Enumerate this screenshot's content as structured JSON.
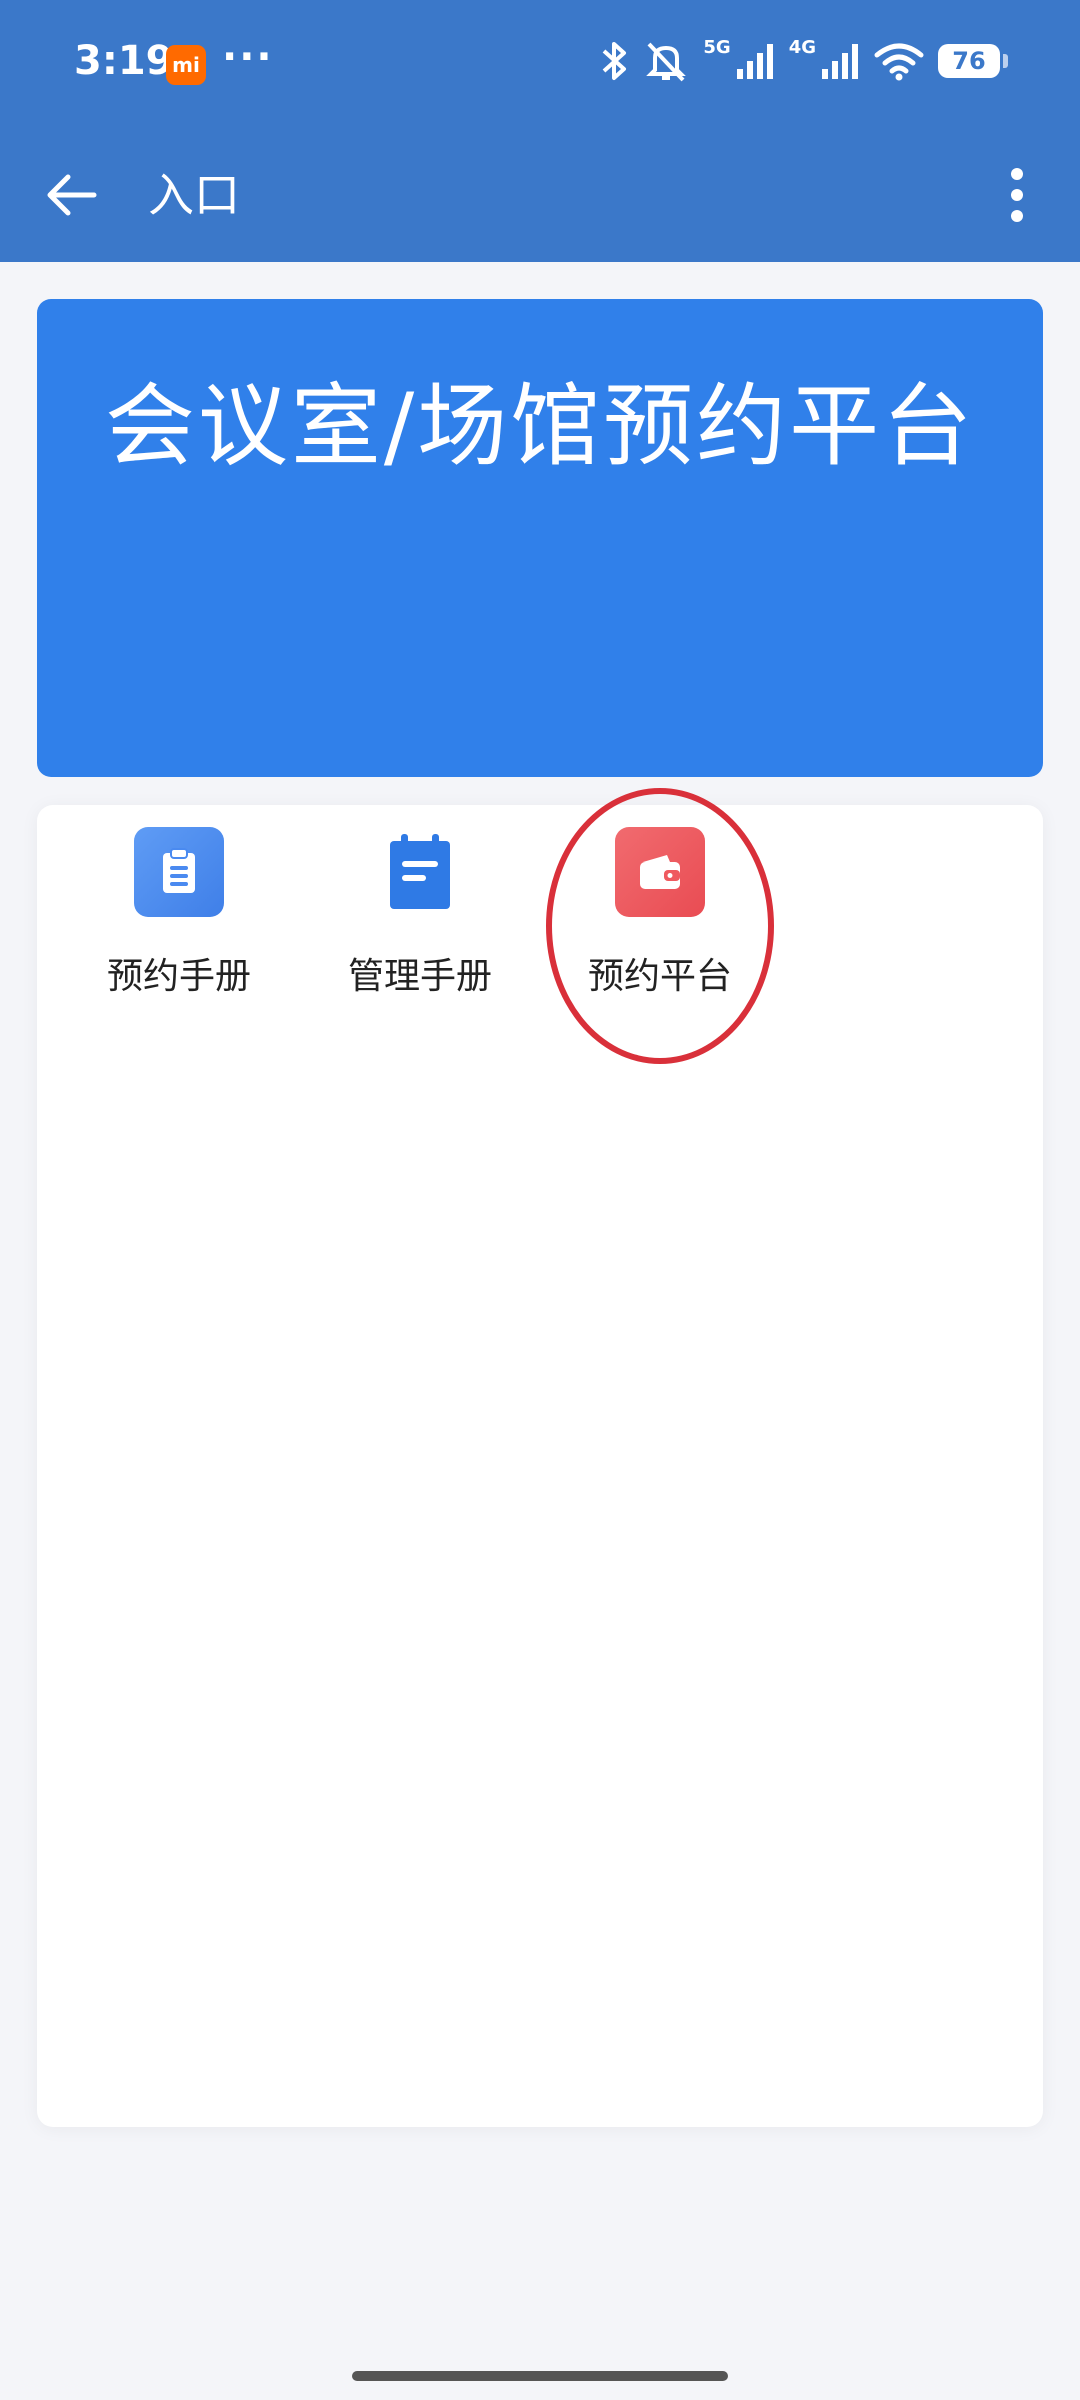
{
  "status_bar": {
    "time": "3:19",
    "badge": "mi",
    "more": "···",
    "network_5g": "5G",
    "network_4g": "4G",
    "battery": "76"
  },
  "app_bar": {
    "title": "入口",
    "back_icon": "arrow-left-icon",
    "menu_icon": "more-vertical-icon"
  },
  "banner": {
    "title": "会议室/场馆预约平台",
    "color": "#3080ea"
  },
  "tiles": [
    {
      "label": "预约手册",
      "icon": "clipboard-icon",
      "color": "#4a8af0"
    },
    {
      "label": "管理手册",
      "icon": "notepad-icon",
      "color": "#2f7ae5"
    },
    {
      "label": "预约平台",
      "icon": "wallet-icon",
      "color": "#ef5a5f"
    }
  ],
  "colors": {
    "toolbar": "#3b78c9",
    "background": "#f4f5f9",
    "annotation": "#d9303a"
  }
}
